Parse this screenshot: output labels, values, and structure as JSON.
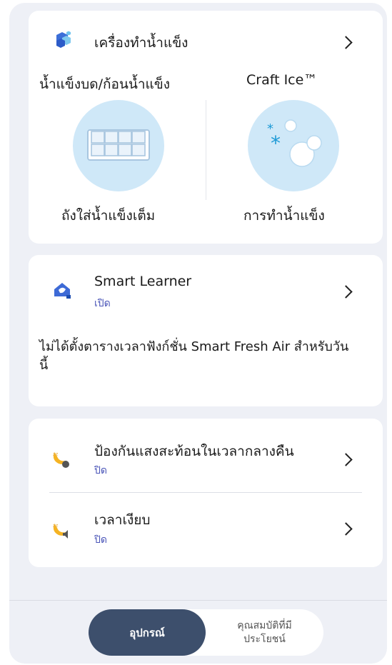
{
  "icemaker": {
    "title": "เครื่องทำน้ำแข็ง",
    "left_title": "น้ำแข็งบด/ก้อนน้ำแข็ง",
    "left_status": "ถังใส่น้ำแข็งเต็ม",
    "right_title": "Craft Ice™",
    "right_status": "การทำน้ำแข็ง"
  },
  "smart_learner": {
    "title": "Smart Learner",
    "status": "เปิด",
    "description": "ไม่ได้ตั้งตารางเวลาฟังก์ชั่น Smart Fresh Air สำหรับวันนี้"
  },
  "settings": [
    {
      "title": "ป้องกันแสงสะท้อนในเวลากลางคืน",
      "status": "ปิด",
      "icon": "moon-lamp-icon"
    },
    {
      "title": "เวลาเงียบ",
      "status": "ปิด",
      "icon": "moon-speaker-icon"
    }
  ],
  "tabs": {
    "active": "อุปกรณ์",
    "inactive": "คุณสมบัติที่มีประโยชน์"
  },
  "colors": {
    "accent": "#4a55b8",
    "tab_active": "#3d4f6c",
    "ice_circle": "#cfe8f8",
    "background": "#eef0f6"
  }
}
